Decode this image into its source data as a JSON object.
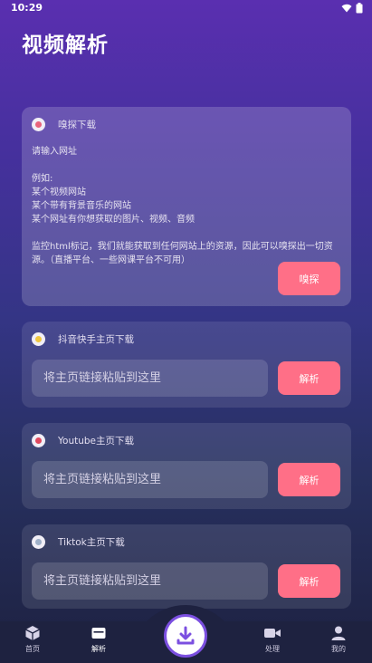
{
  "status": {
    "time": "10:29"
  },
  "page": {
    "title": "视频解析"
  },
  "sniff_card": {
    "title": "嗅探下载",
    "body": "请输入网址\n\n例如:\n某个视频网站\n某个带有背景音乐的网站\n某个网址有你想获取的图片、视频、音频\n\n监控html标记，我们就能获取到任何网站上的资源，因此可以嗅探出一切资源。（直播平台、一些网课平台不可用）",
    "button": "嗅探",
    "dot_color": "#e8637b"
  },
  "download_cards": [
    {
      "title": "抖音快手主页下载",
      "placeholder": "将主页链接粘贴到这里",
      "button": "解析",
      "dot_color": "#f0c640"
    },
    {
      "title": "Youtube主页下载",
      "placeholder": "将主页链接粘贴到这里",
      "button": "解析",
      "dot_color": "#e0485e"
    },
    {
      "title": "Tiktok主页下载",
      "placeholder": "将主页链接粘贴到这里",
      "button": "解析",
      "dot_color": "#9fb0c8"
    }
  ],
  "nav": {
    "items": [
      {
        "label": "首页",
        "icon": "cube-icon"
      },
      {
        "label": "解析",
        "icon": "folder-icon"
      },
      {
        "label": "处理",
        "icon": "video-camera-icon"
      },
      {
        "label": "我的",
        "icon": "person-icon"
      }
    ],
    "active": "解析",
    "center_icon": "download-icon"
  },
  "colors": {
    "accent": "#ff6f87",
    "fab_border": "#7b4fe0"
  }
}
